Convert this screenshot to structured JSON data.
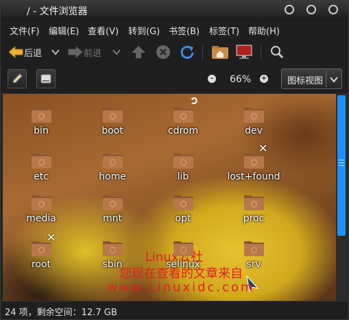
{
  "window": {
    "title": "/ - 文件浏览器"
  },
  "menubar": [
    "文件(F)",
    "编辑(E)",
    "查看(V)",
    "转到(G)",
    "书签(B)",
    "标签(T)",
    "帮助(H)"
  ],
  "toolbar": {
    "back_label": "后退",
    "forward_label": "前进"
  },
  "zoom": {
    "level": "66%",
    "minus": "-",
    "plus": "+"
  },
  "view_select": {
    "selected": "图标视图"
  },
  "folders": [
    "bin",
    "boot",
    "cdrom",
    "dev",
    "etc",
    "home",
    "lib",
    "lost+found",
    "media",
    "mnt",
    "opt",
    "proc",
    "root",
    "sbin",
    "selinux",
    "srv"
  ],
  "watermark": {
    "line1": "Linux公社",
    "line2": "您现在查看的文章来自",
    "line3": "www.Linuxidc.com"
  },
  "status": {
    "text": "24 项，剩余空间：12.7 GB"
  },
  "colors": {
    "accent": "#1e90ff",
    "folder": "#a8683a",
    "watermark": "#e02020"
  }
}
